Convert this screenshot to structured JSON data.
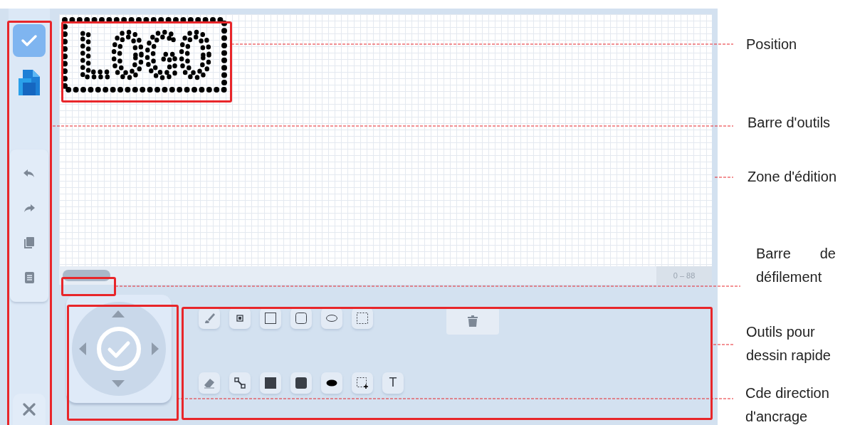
{
  "canvas": {
    "logo": "LOGO",
    "range_label": "0 – 88"
  },
  "drawing_tools": {
    "text_tool_label": "T"
  },
  "annotations": [
    {
      "label": "Position"
    },
    {
      "label": "Barre d'outils"
    },
    {
      "label": "Zone d'édition"
    },
    {
      "label": "Barre de défilement"
    },
    {
      "label": "Outils pour dessin rapide"
    },
    {
      "label": "Cde direction d'ancrage"
    }
  ]
}
